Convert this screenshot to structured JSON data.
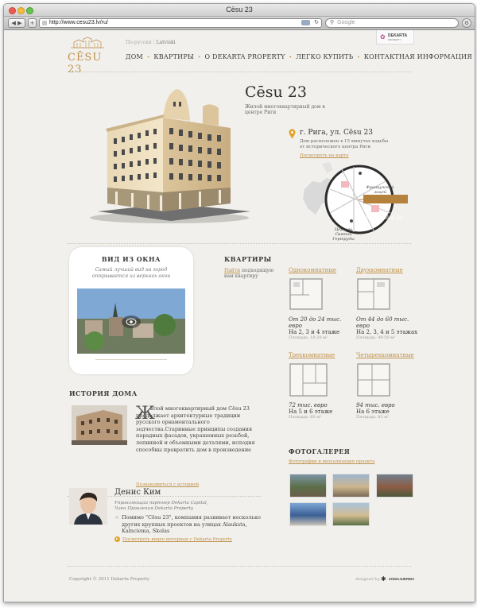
{
  "browser": {
    "window_title": "Cēsu 23",
    "url": "http://www.cesu23.lv/ru/",
    "search_placeholder": "Google"
  },
  "header": {
    "logo_text": "CĒSU 23",
    "lang_ru": "По-русски",
    "lang_lv": "Latviski",
    "brand_badge": "DEKARTA",
    "brand_badge_sub": "PROPERTY",
    "nav": [
      "ДОМ",
      "КВАРТИРЫ",
      "О DEKARTA PROPERTY",
      "ЛЕГКО КУПИТЬ",
      "КОНТАКТНАЯ ИНФОРМАЦИЯ"
    ]
  },
  "hero": {
    "title": "Cēsu 23",
    "subtitle": "Жилой многоквартирный дом в центре Риги",
    "address": "г. Рига, ул. Cēsu 23",
    "address_note": "Дом расположен в 15 минутах ходьбы от исторического центра Риги",
    "map_link": "Посмотреть на карте",
    "map_label_top": "Французский лицей",
    "map_pin_label": "дом на Cēsu 23",
    "map_label_bottom": "Церковь Святой Гертруды"
  },
  "view": {
    "heading": "ВИД ИЗ ОКНА",
    "text": "Самый лучший вид на город открывается из верхних окон"
  },
  "apartments": {
    "heading": "КВАРТИРЫ",
    "intro_link": "Найти",
    "intro_text": "подходящую вам квартиру",
    "items": [
      {
        "name": "Однокомнатные",
        "price": "От 20 до 24 тыс. евро",
        "floors": "На 2, 3 и 4 этаже",
        "area": "Площадь: 18-20 м²"
      },
      {
        "name": "Двухкомнатные",
        "price": "От 44 до 60 тыс. евро",
        "floors": "На 2, 3, 4 и 5 этажах",
        "area": "Площадь: 40-50 м²"
      },
      {
        "name": "Трехкомнатные",
        "price": "72 тыс. евро",
        "floors": "На 5 и 6 этаже",
        "area": "Площадь: 60 м²"
      },
      {
        "name": "Четырехкомнатные",
        "price": "94 тыс. евро",
        "floors": "На 6 этаже",
        "area": "Площадь: 82 м²"
      }
    ]
  },
  "history": {
    "heading": "ИСТОРИЯ ДОМА",
    "drop_cap": "Ж",
    "text": "илой многоквартирный дом Cēsu 23 продолжает архитектурные традиции русского орнаментального зодчества.Старинные принципы создания парадных фасадов, украшенных резьбой, лепниной и объемными деталями, исподня способны превратить дом в произведение",
    "link": "Познакомиться с историей"
  },
  "gallery": {
    "heading": "ФОТОГАЛЕРЕЯ",
    "link": "Фотографии и визуализация проекта"
  },
  "testimonial": {
    "name": "Денис Ким",
    "role": "Управляющий партнер Dekarta Capital, Член Правления Dekarta Property",
    "quote": "Помимо \"Cēsu 23\", компания развивает несколько других крупных проектов на улицах Alauksta, Kalnciema, Skolas",
    "link": "Посмотреть видео интервью с Dekarta Property"
  },
  "footer": {
    "copyright": "Copyright © 2011 Dekarta Property",
    "designed_by": "designed by",
    "designer": "ZOMAJUERMA"
  },
  "colors": {
    "accent": "#c0914a",
    "background": "#f1f0ec",
    "text": "#3a3a3a"
  }
}
